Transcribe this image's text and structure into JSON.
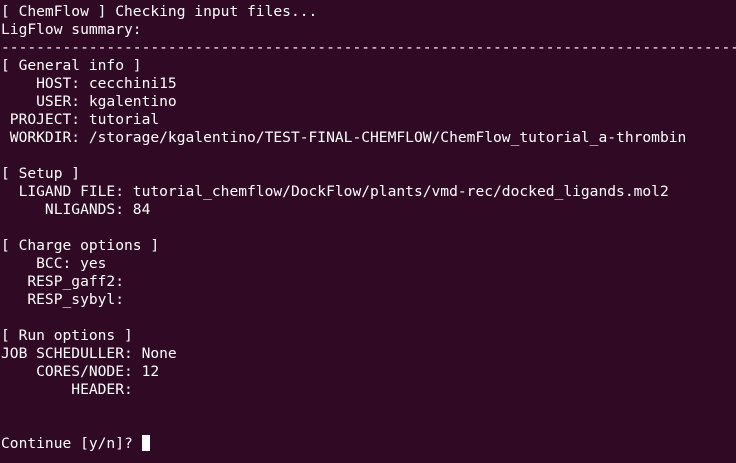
{
  "terminal": {
    "lines": [
      "[ ChemFlow ] Checking input files...",
      "LigFlow summary:",
      "-------------------------------------------------------------------------------------",
      "[ General info ]",
      "    HOST: cecchini15",
      "    USER: kgalentino",
      " PROJECT: tutorial",
      " WORKDIR: /storage/kgalentino/TEST-FINAL-CHEMFLOW/ChemFlow_tutorial_a-thrombin",
      "",
      "[ Setup ]",
      "  LIGAND FILE: tutorial_chemflow/DockFlow/plants/vmd-rec/docked_ligands.mol2",
      "     NLIGANDS: 84",
      "",
      "[ Charge options ]",
      "    BCC: yes",
      "   RESP_gaff2:",
      "   RESP_sybyl:",
      "",
      "[ Run options ]",
      "JOB SCHEDULLER: None",
      "    CORES/NODE: 12",
      "        HEADER:",
      "",
      "",
      "Continue [y/n]? "
    ]
  },
  "colors": {
    "background": "#300a24",
    "foreground": "#ffffff",
    "cursor": "#ffffff"
  }
}
